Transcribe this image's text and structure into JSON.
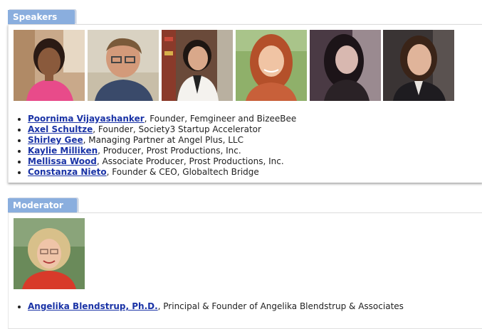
{
  "sections": {
    "speakers": {
      "heading": "Speakers",
      "items": [
        {
          "name": "Poornima Vijayashanker",
          "title": ", Founder, Femgineer and BizeeBee"
        },
        {
          "name": "Axel Schultze",
          "title": ", Founder, Society3 Startup Accelerator"
        },
        {
          "name": "Shirley Gee",
          "title": ", Managing Partner at Angel Plus, LLC"
        },
        {
          "name": "Kaylie Milliken",
          "title": ", Producer, Prost Productions, Inc."
        },
        {
          "name": "Mellissa Wood",
          "title": ", Associate Producer, Prost Productions, Inc."
        },
        {
          "name": "Constanza Nieto",
          "title": ", Founder & CEO, Globaltech Bridge"
        }
      ]
    },
    "moderator": {
      "heading": "Moderator",
      "items": [
        {
          "name": "Angelika Blendstrup, Ph.D.",
          "title": ", Principal & Founder of Angelika Blendstrup & Associates"
        }
      ]
    }
  },
  "colors": {
    "tab_background": "#8aaede",
    "link": "#1a33a6",
    "text": "#222222"
  }
}
